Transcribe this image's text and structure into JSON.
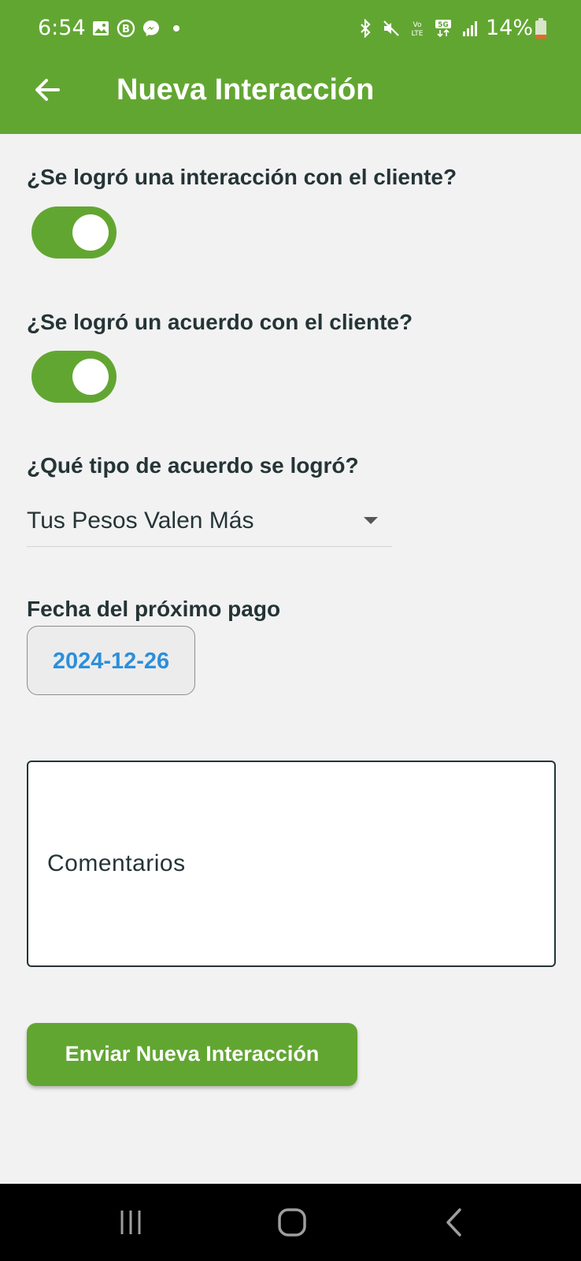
{
  "status_bar": {
    "time": "6:54",
    "battery": "14%",
    "left_icons": [
      "gallery-icon",
      "business-chat-icon",
      "messenger-icon",
      "dot-icon"
    ],
    "right_icons": [
      "bluetooth-icon",
      "mute-icon",
      "volte-icon",
      "5g-icon",
      "signal-icon",
      "battery-icon"
    ]
  },
  "app_bar": {
    "title": "Nueva Interacción",
    "back_icon": "arrow-back-icon"
  },
  "form": {
    "q_interaction": "¿Se logró una interacción con el cliente?",
    "q_interaction_on": true,
    "q_agreement": "¿Se logró un acuerdo con el cliente?",
    "q_agreement_on": true,
    "q_agreement_type": "¿Qué tipo de acuerdo se logró?",
    "agreement_type_value": "Tus Pesos Valen Más",
    "next_payment_label": "Fecha del próximo pago",
    "next_payment_date": "2024-12-26",
    "comments_placeholder": "Comentarios",
    "submit_label": "Enviar Nueva Interacción"
  },
  "colors": {
    "brand_green": "#62a632",
    "text_dark": "#253436",
    "date_blue": "#2b8fdb",
    "background": "#f2f2f2"
  },
  "nav_bar": {
    "buttons": [
      "recent-apps-icon",
      "home-icon",
      "back-icon"
    ]
  }
}
